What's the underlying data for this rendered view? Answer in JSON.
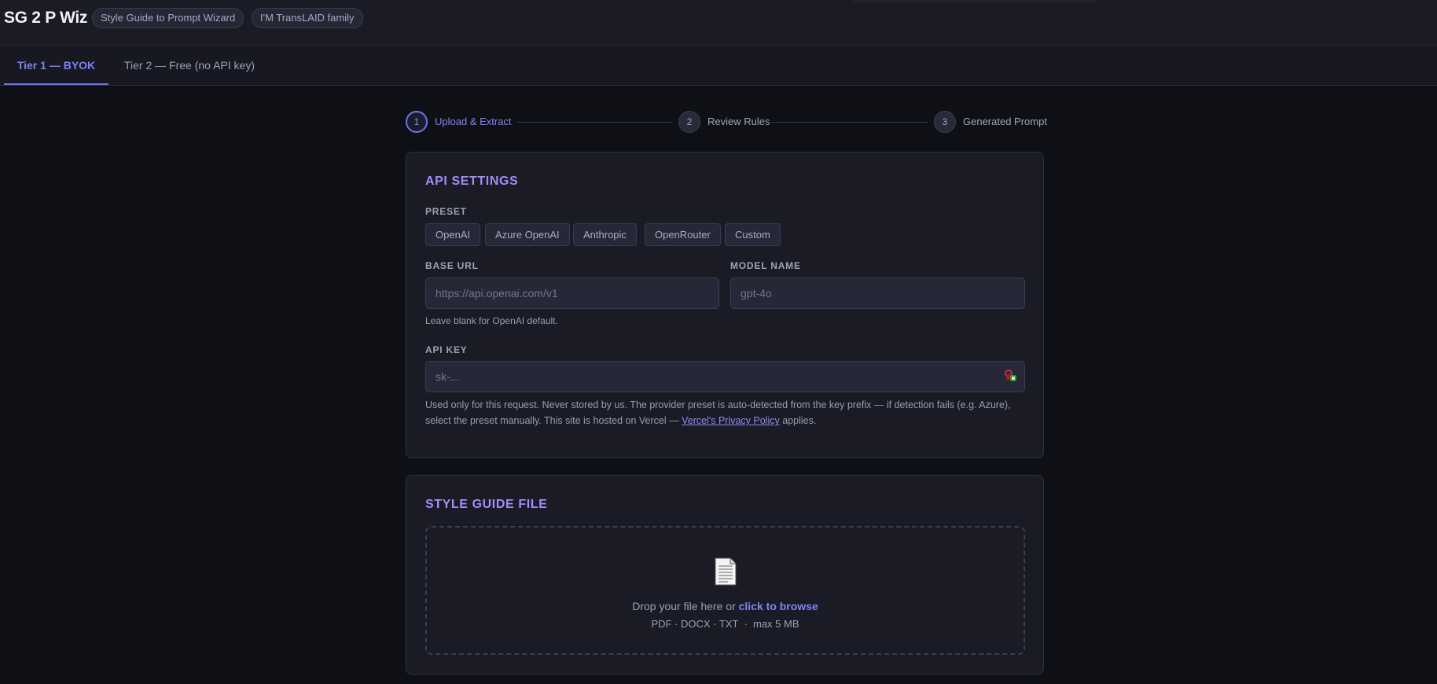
{
  "header": {
    "title": "SG 2 P Wiz",
    "chips": [
      "Style Guide to Prompt Wizard",
      "I'M TransLAID family"
    ]
  },
  "tabs": [
    {
      "label": "Tier 1 — BYOK",
      "active": true
    },
    {
      "label": "Tier 2 — Free (no API key)",
      "active": false
    }
  ],
  "stepper": [
    {
      "number": "1",
      "label": "Upload & Extract",
      "active": true
    },
    {
      "number": "2",
      "label": "Review Rules",
      "active": false
    },
    {
      "number": "3",
      "label": "Generated Prompt",
      "active": false
    }
  ],
  "api_settings": {
    "title": "API SETTINGS",
    "preset_label": "PRESET",
    "presets": [
      "OpenAI",
      "Azure OpenAI",
      "Anthropic",
      "OpenRouter",
      "Custom"
    ],
    "base_url_label": "BASE URL",
    "base_url_placeholder": "https://api.openai.com/v1",
    "base_url_value": "",
    "base_url_hint": "Leave blank for OpenAI default.",
    "model_label": "MODEL NAME",
    "model_placeholder": "gpt-4o",
    "model_value": "",
    "api_key_label": "API KEY",
    "api_key_placeholder": "sk-...",
    "api_key_value": "",
    "help_text_1": "Used only for this request. Never stored by us. The provider preset is auto-detected from the key prefix — if detection fails (e.g. Azure), select the preset manually. This site is hosted on Vercel — ",
    "help_link": "Vercel's Privacy Policy",
    "help_text_2": " applies."
  },
  "style_guide": {
    "title": "STYLE GUIDE FILE",
    "drop_text": "Drop your file here or ",
    "browse_text": "click to browse",
    "file_types": "PDF · DOCX · TXT  ·  max 5 MB"
  },
  "icons": {
    "document": "document-icon",
    "password_manager": "key-icon"
  },
  "colors": {
    "accent": "#6c74f0",
    "section_title": "#a48bf7",
    "background": "#0f1015",
    "card": "#1a1b25"
  }
}
